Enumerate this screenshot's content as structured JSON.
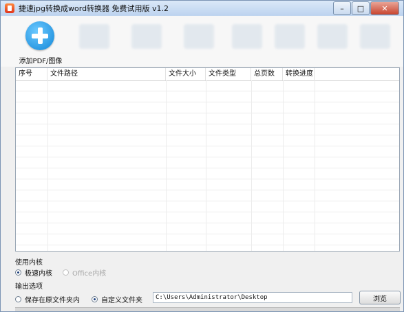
{
  "window": {
    "title": "捷速jpg转换成word转换器 免费试用版 v1.2"
  },
  "toolbar": {
    "add_pdf_label": "添加PDF/图像"
  },
  "table": {
    "columns": [
      "序号",
      "文件路径",
      "文件大小",
      "文件类型",
      "总页数",
      "转换进度"
    ]
  },
  "engine": {
    "section_label": "使用内核",
    "fast_label": "极速内核",
    "office_label": "Office内核",
    "selected": "极速内核"
  },
  "output": {
    "section_label": "输出选项",
    "keep_original_label": "保存在原文件夹内",
    "custom_folder_label": "自定义文件夹",
    "selected": "自定义文件夹",
    "path_value": "C:\\Users\\Administrator\\Desktop",
    "browse_label": "浏览"
  }
}
